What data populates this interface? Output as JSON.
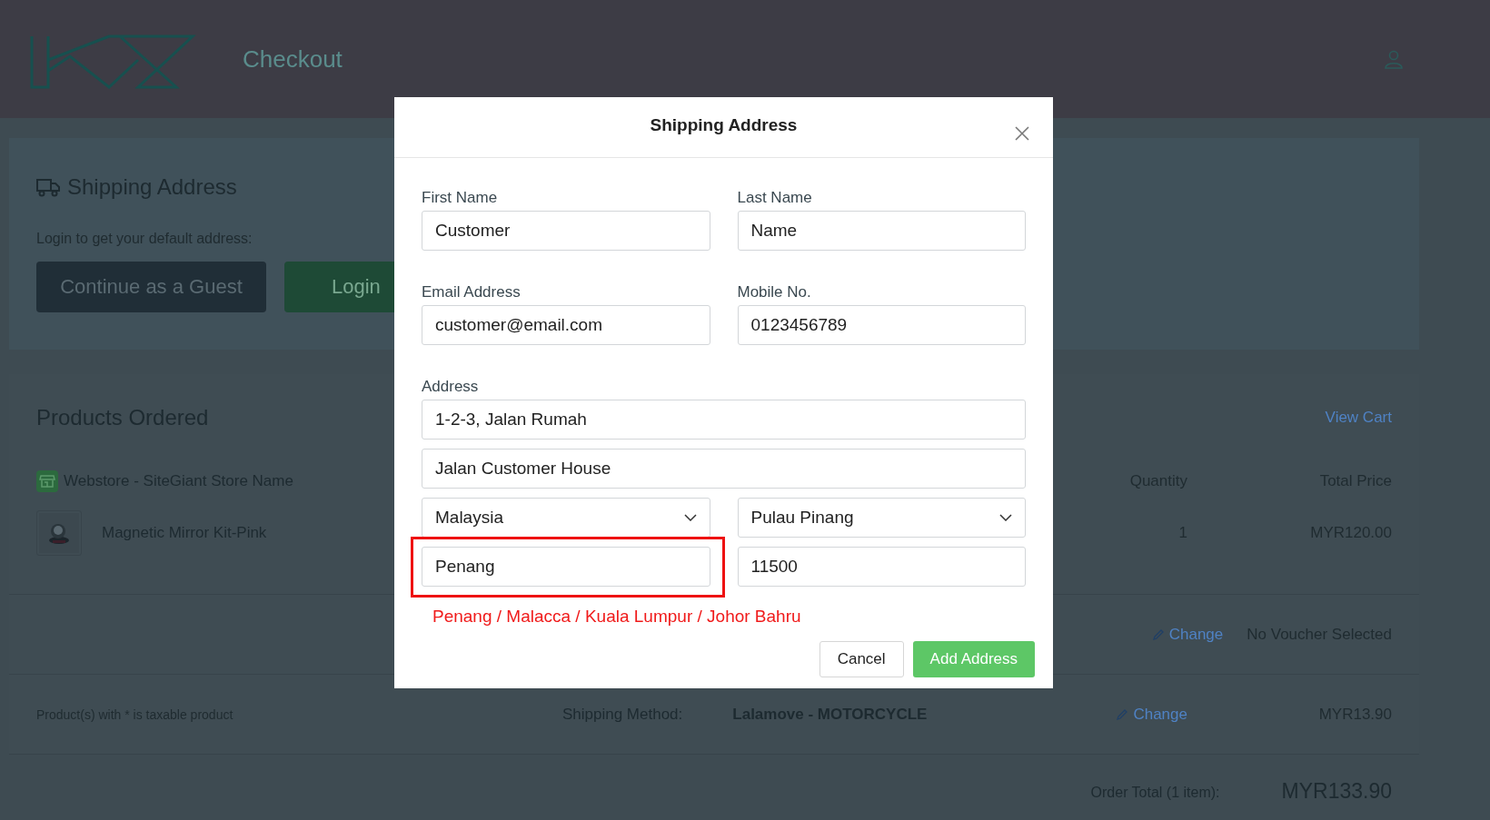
{
  "header": {
    "title": "Checkout"
  },
  "shipping": {
    "title": "Shipping Address",
    "prompt": "Login to get your default address:",
    "buttons": [
      {
        "label": "Continue as a Guest",
        "kind": "guest"
      },
      {
        "label": "Login",
        "kind": "login"
      }
    ]
  },
  "products": {
    "title": "Products Ordered",
    "view_cart": "View Cart",
    "store": "Webstore - SiteGiant Store Name",
    "columns": [
      "Quantity",
      "Total Price"
    ],
    "rows": [
      {
        "name": "Magnetic Mirror Kit-Pink",
        "quantity": "1",
        "total": "MYR120.00"
      }
    ]
  },
  "voucher": {
    "change": "Change",
    "value": "No Voucher Selected"
  },
  "shipping_method": {
    "note": "Product(s) with * is taxable product",
    "label": "Shipping Method:",
    "method": "Lalamove - MOTORCYCLE",
    "change": "Change",
    "price": "MYR13.90"
  },
  "order_total": {
    "label": "Order Total (1 item):",
    "value": "MYR133.90"
  },
  "dialog": {
    "title": "Shipping Address",
    "rows": [
      [
        {
          "label": "First Name",
          "value": "Customer",
          "kind": "input",
          "highlighted": false
        },
        {
          "label": "Last Name",
          "value": "Name",
          "kind": "input",
          "highlighted": false
        }
      ],
      [
        {
          "label": "Email Address",
          "value": "customer@email.com",
          "kind": "input",
          "highlighted": false
        },
        {
          "label": "Mobile No.",
          "value": "0123456789",
          "kind": "input",
          "highlighted": false
        }
      ],
      [
        {
          "label": "Address",
          "value": "1-2-3, Jalan Rumah",
          "kind": "input",
          "highlighted": false
        }
      ],
      [
        {
          "value": "Jalan Customer House",
          "kind": "input",
          "highlighted": false
        }
      ],
      [
        {
          "value": "Malaysia",
          "kind": "select",
          "highlighted": false
        },
        {
          "value": "Pulau Pinang",
          "kind": "select",
          "highlighted": false
        }
      ],
      [
        {
          "value": "Penang",
          "kind": "input",
          "highlighted": true
        },
        {
          "value": "11500",
          "kind": "input",
          "highlighted": false
        }
      ]
    ],
    "hint": "Penang / Malacca / Kuala Lumpur / Johor Bahru",
    "buttons": [
      {
        "label": "Cancel",
        "kind": "secondary"
      },
      {
        "label": "Add Address",
        "kind": "primary"
      }
    ]
  }
}
